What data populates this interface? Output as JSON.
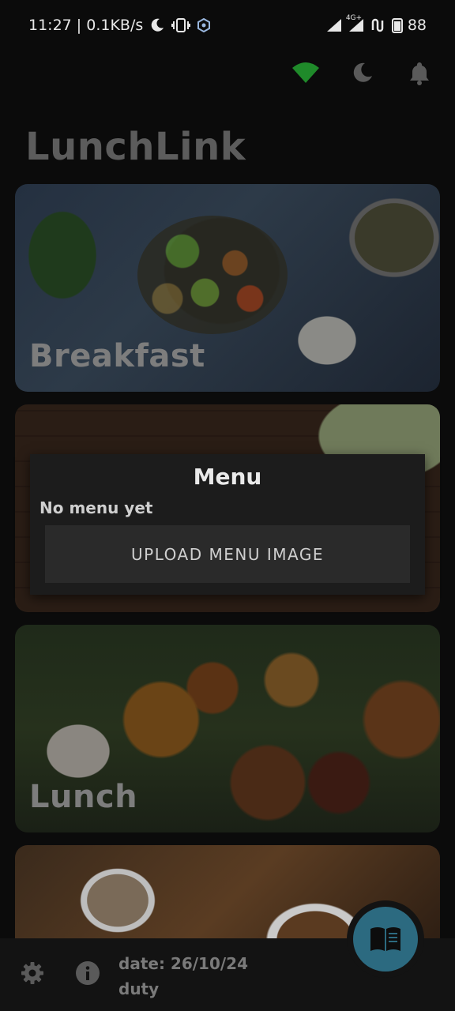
{
  "status_bar": {
    "time_speed": "11:27 | 0.1KB/s",
    "network": "4G+",
    "battery": "88",
    "icons": [
      "moon-icon",
      "vibrate-icon",
      "vpn-icon",
      "signal-icon",
      "signal-4g-icon",
      "nfc-icon",
      "battery-icon"
    ]
  },
  "top_actions": [
    "wifi-icon",
    "dark-mode-icon",
    "notifications-icon"
  ],
  "app": {
    "title": "LunchLink"
  },
  "cards": {
    "breakfast": {
      "label": "Breakfast"
    },
    "lunch": {
      "label": "Lunch"
    }
  },
  "menu_panel": {
    "title": "Menu",
    "status": "No menu yet",
    "upload_label": "UPLOAD MENU IMAGE"
  },
  "bottom_bar": {
    "date": "date: 26/10/24",
    "duty": "duty",
    "icons": [
      "settings-icon",
      "info-icon"
    ],
    "fab_icon": "menu-book-icon"
  },
  "colors": {
    "accent": "#2c6a80",
    "wifi_green": "#1f8a2a",
    "background": "#0b0b0b"
  }
}
